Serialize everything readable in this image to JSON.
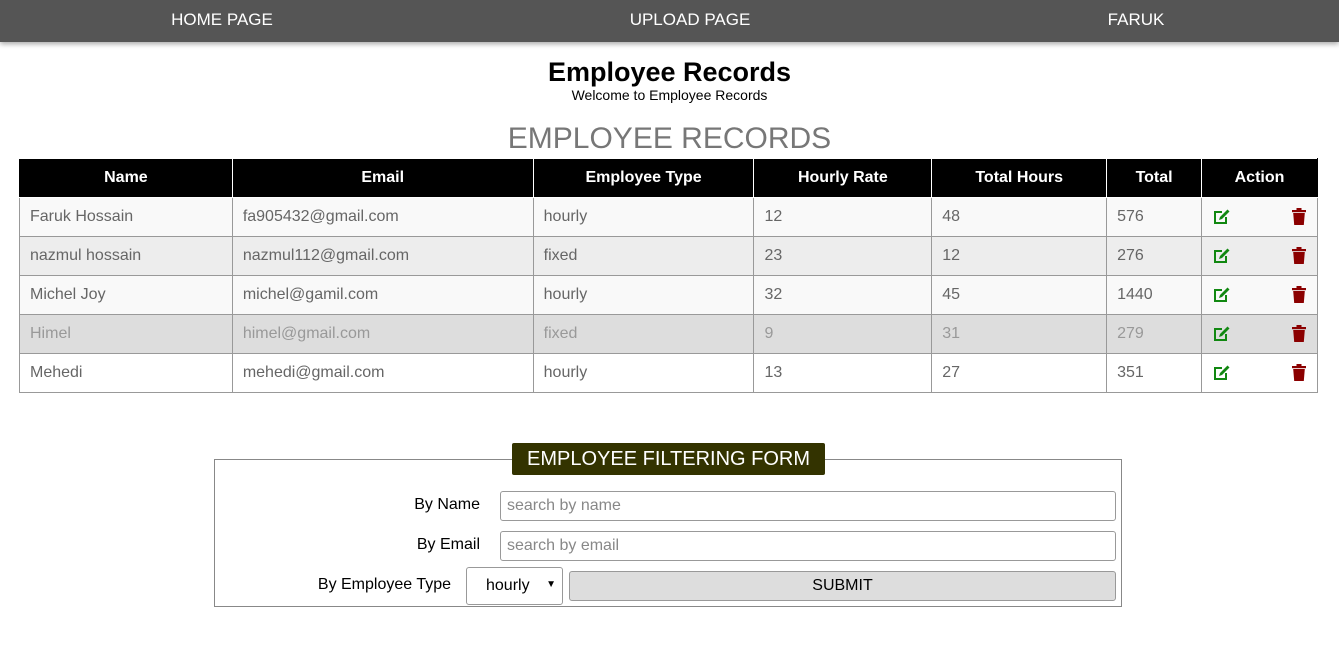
{
  "nav": {
    "items": [
      {
        "label": "HOME PAGE"
      },
      {
        "label": "UPLOAD PAGE"
      },
      {
        "label": "FARUK"
      }
    ]
  },
  "header": {
    "title": "Employee Records",
    "subtitle": "Welcome to Employee Records"
  },
  "records": {
    "section_title": "EMPLOYEE RECORDS",
    "columns": [
      "Name",
      "Email",
      "Employee Type",
      "Hourly Rate",
      "Total Hours",
      "Total",
      "Action"
    ],
    "rows": [
      {
        "name": "Faruk Hossain",
        "email": "fa905432@gmail.com",
        "type": "hourly",
        "rate": "12",
        "hours": "48",
        "total": "576"
      },
      {
        "name": "nazmul hossain",
        "email": "nazmul112@gmail.com",
        "type": "fixed",
        "rate": "23",
        "hours": "12",
        "total": "276"
      },
      {
        "name": "Michel Joy",
        "email": "michel@gamil.com",
        "type": "hourly",
        "rate": "32",
        "hours": "45",
        "total": "1440"
      },
      {
        "name": "Himel",
        "email": "himel@gmail.com",
        "type": "fixed",
        "rate": "9",
        "hours": "31",
        "total": "279"
      },
      {
        "name": "Mehedi",
        "email": "mehedi@gmail.com",
        "type": "hourly",
        "rate": "13",
        "hours": "27",
        "total": "351"
      }
    ],
    "icons": {
      "edit": "edit-icon",
      "delete": "trash-icon"
    },
    "colors": {
      "edit": "#118811",
      "delete": "#8b0000",
      "header_bg": "#000000"
    }
  },
  "filter": {
    "legend": "EMPLOYEE FILTERING FORM",
    "name_label": "By Name",
    "name_placeholder": "search by name",
    "name_value": "",
    "email_label": "By Email",
    "email_placeholder": "search by email",
    "email_value": "",
    "type_label": "By Employee Type",
    "type_selected": "hourly",
    "submit_label": "SUBMIT",
    "legend_color": "#333300"
  }
}
